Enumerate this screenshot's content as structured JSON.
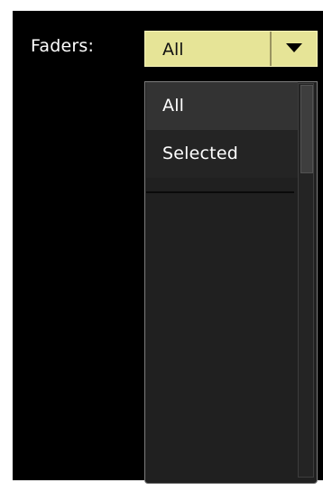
{
  "faders": {
    "label": "Faders:",
    "selected": "All",
    "options": [
      "All",
      "Selected"
    ]
  },
  "icons": {
    "dropdown_arrow": "caret-down-icon"
  },
  "colors": {
    "combo_background": "#e6e497",
    "panel_background": "#000000",
    "dropdown_background": "#202020",
    "highlighted_item": "#333333"
  }
}
